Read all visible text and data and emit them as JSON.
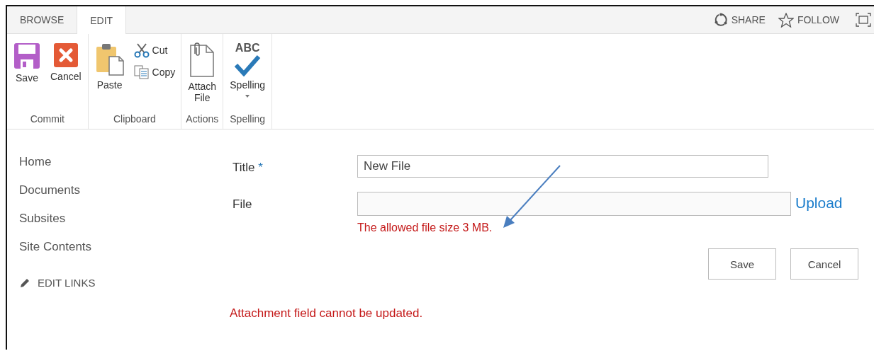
{
  "tabs": [
    {
      "label": "BROWSE",
      "selected": false
    },
    {
      "label": "EDIT",
      "selected": true
    }
  ],
  "top_actions": [
    {
      "label": "SHARE"
    },
    {
      "label": "FOLLOW"
    }
  ],
  "ribbon": [
    {
      "name": "Commit",
      "buttons": [
        {
          "kind": "large",
          "label": "Save"
        },
        {
          "kind": "large",
          "label": "Cancel"
        }
      ]
    },
    {
      "name": "Clipboard",
      "buttons": [
        {
          "kind": "large",
          "label": "Paste"
        },
        {
          "kind": "small",
          "label": "Cut"
        },
        {
          "kind": "small",
          "label": "Copy"
        }
      ]
    },
    {
      "name": "Actions",
      "buttons": [
        {
          "kind": "large",
          "label": "Attach File"
        }
      ]
    },
    {
      "name": "Spelling",
      "buttons": [
        {
          "kind": "large",
          "label": "Spelling",
          "icon_text": "ABC",
          "dropdown": true
        }
      ]
    }
  ],
  "nav": [
    "Home",
    "Documents",
    "Subsites",
    "Site Contents"
  ],
  "edit_links": "EDIT LINKS",
  "form": {
    "fields": [
      {
        "kind": "text",
        "label": "Title",
        "required_mark": "*",
        "value": "New File"
      },
      {
        "kind": "file",
        "label": "File",
        "link": "Upload",
        "error": "The allowed file size 3 MB."
      }
    ],
    "buttons": [
      "Save",
      "Cancel"
    ],
    "message": "Attachment field cannot be updated."
  }
}
